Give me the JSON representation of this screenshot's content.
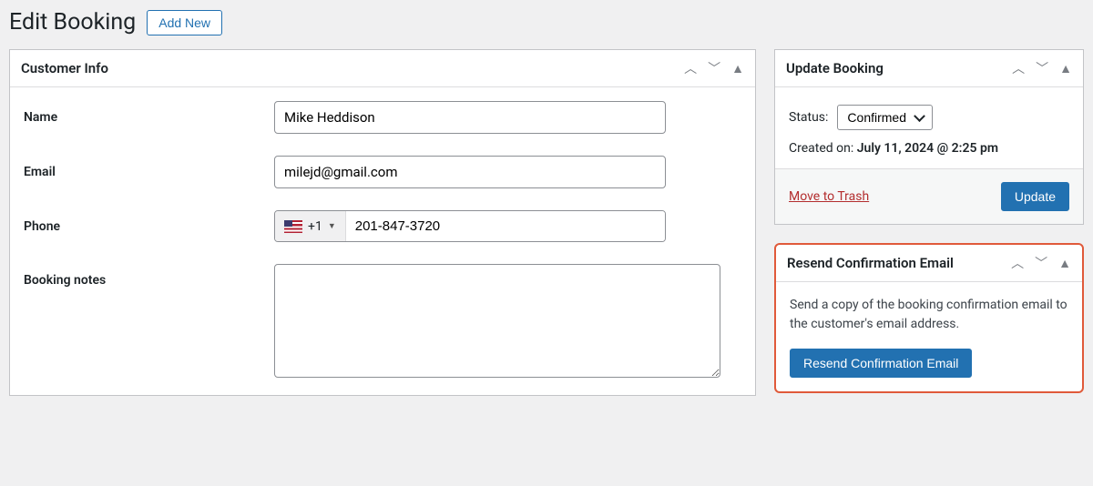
{
  "header": {
    "title": "Edit Booking",
    "add_new_label": "Add New"
  },
  "customer_info": {
    "panel_title": "Customer Info",
    "labels": {
      "name": "Name",
      "email": "Email",
      "phone": "Phone",
      "notes": "Booking notes"
    },
    "values": {
      "name": "Mike Heddison",
      "email": "milejd@gmail.com",
      "phone_code": "+1",
      "phone_number": "201-847-3720",
      "notes": ""
    }
  },
  "update_booking": {
    "panel_title": "Update Booking",
    "status_label": "Status:",
    "status_value": "Confirmed",
    "created_label": "Created on:",
    "created_value": "July 11, 2024 @ 2:25 pm",
    "trash_label": "Move to Trash",
    "update_label": "Update"
  },
  "resend": {
    "panel_title": "Resend Confirmation Email",
    "description": "Send a copy of the booking confirmation email to the customer's email address.",
    "button_label": "Resend Confirmation Email"
  }
}
